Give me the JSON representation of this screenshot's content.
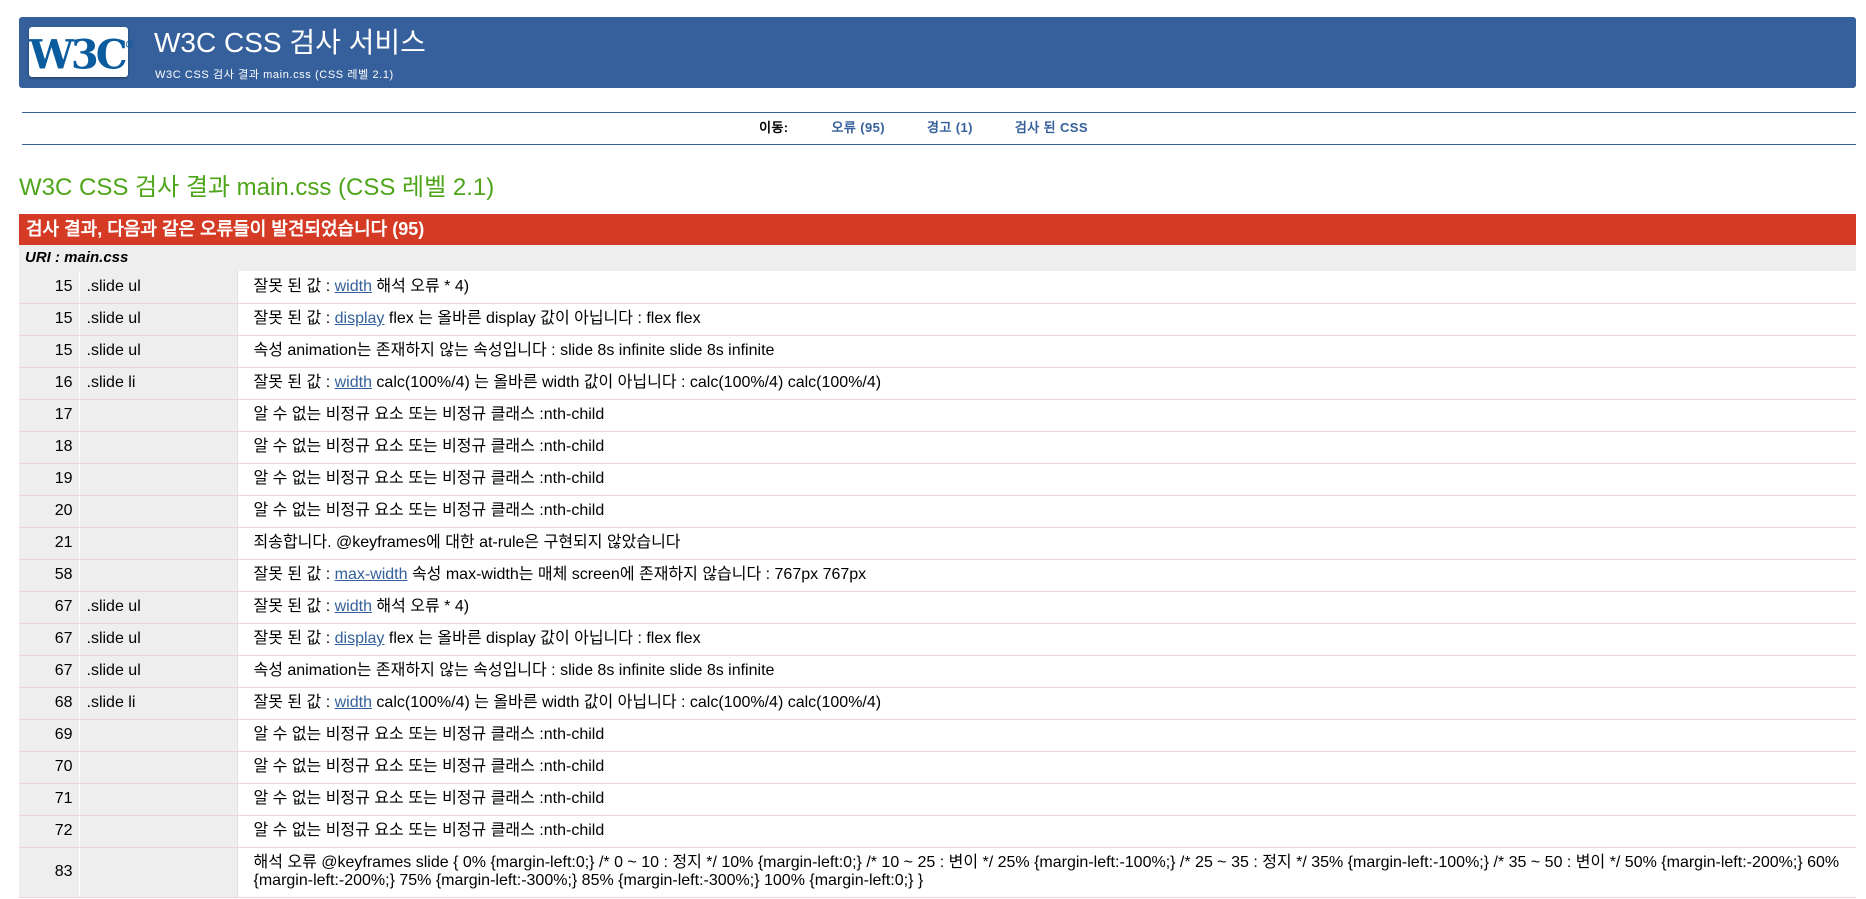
{
  "header": {
    "logo_text": "W3C",
    "title": "W3C CSS 검사 서비스",
    "subtitle": "W3C CSS 검사 결과 main.css (CSS 레벨 2.1)"
  },
  "jump": {
    "label": "이동:",
    "links": [
      "오류 (95)",
      "경고 (1)",
      "검사 된 CSS"
    ]
  },
  "result_title": "W3C CSS 검사 결과 main.css (CSS 레벨 2.1)",
  "errors_header": "검사 결과, 다음과 같은 오류들이 발견되었습니다 (95)",
  "uri": "URI : main.css",
  "errors": [
    {
      "line": "15",
      "ctx": ".slide ul",
      "pre": "잘못 된 값 : ",
      "prop": "width",
      "post": " 해석 오류 * 4)"
    },
    {
      "line": "15",
      "ctx": ".slide ul",
      "pre": "잘못 된 값 : ",
      "prop": "display",
      "post": " flex 는 올바른 display 값이 아닙니다 : flex flex"
    },
    {
      "line": "15",
      "ctx": ".slide ul",
      "pre": "속성 animation는 존재하지 않는 속성입니다 : slide 8s infinite slide 8s infinite",
      "prop": "",
      "post": ""
    },
    {
      "line": "16",
      "ctx": ".slide li",
      "pre": "잘못 된 값 : ",
      "prop": "width",
      "post": " calc(100%/4) 는 올바른 width 값이 아닙니다 : calc(100%/4) calc(100%/4)"
    },
    {
      "line": "17",
      "ctx": "",
      "pre": "알 수 없는 비정규 요소 또는 비정규 클래스 :nth-child",
      "prop": "",
      "post": ""
    },
    {
      "line": "18",
      "ctx": "",
      "pre": "알 수 없는 비정규 요소 또는 비정규 클래스 :nth-child",
      "prop": "",
      "post": ""
    },
    {
      "line": "19",
      "ctx": "",
      "pre": "알 수 없는 비정규 요소 또는 비정규 클래스 :nth-child",
      "prop": "",
      "post": ""
    },
    {
      "line": "20",
      "ctx": "",
      "pre": "알 수 없는 비정규 요소 또는 비정규 클래스 :nth-child",
      "prop": "",
      "post": ""
    },
    {
      "line": "21",
      "ctx": "",
      "pre": "죄송합니다. @keyframes에 대한 at-rule은 구현되지 않았습니다",
      "prop": "",
      "post": ""
    },
    {
      "line": "58",
      "ctx": "",
      "pre": "잘못 된 값 : ",
      "prop": "max-width",
      "post": " 속성 max-width는 매체 screen에 존재하지 않습니다 : 767px 767px"
    },
    {
      "line": "67",
      "ctx": ".slide ul",
      "pre": "잘못 된 값 : ",
      "prop": "width",
      "post": " 해석 오류 * 4)"
    },
    {
      "line": "67",
      "ctx": ".slide ul",
      "pre": "잘못 된 값 : ",
      "prop": "display",
      "post": " flex 는 올바른 display 값이 아닙니다 : flex flex"
    },
    {
      "line": "67",
      "ctx": ".slide ul",
      "pre": "속성 animation는 존재하지 않는 속성입니다 : slide 8s infinite slide 8s infinite",
      "prop": "",
      "post": ""
    },
    {
      "line": "68",
      "ctx": ".slide li",
      "pre": "잘못 된 값 : ",
      "prop": "width",
      "post": " calc(100%/4) 는 올바른 width 값이 아닙니다 : calc(100%/4) calc(100%/4)"
    },
    {
      "line": "69",
      "ctx": "",
      "pre": "알 수 없는 비정규 요소 또는 비정규 클래스 :nth-child",
      "prop": "",
      "post": ""
    },
    {
      "line": "70",
      "ctx": "",
      "pre": "알 수 없는 비정규 요소 또는 비정규 클래스 :nth-child",
      "prop": "",
      "post": ""
    },
    {
      "line": "71",
      "ctx": "",
      "pre": "알 수 없는 비정규 요소 또는 비정규 클래스 :nth-child",
      "prop": "",
      "post": ""
    },
    {
      "line": "72",
      "ctx": "",
      "pre": "알 수 없는 비정규 요소 또는 비정규 클래스 :nth-child",
      "prop": "",
      "post": ""
    },
    {
      "line": "83",
      "ctx": "",
      "pre": "해석 오류 @keyframes slide { 0% {margin-left:0;} /* 0 ~ 10 : 정지 */ 10% {margin-left:0;} /* 10 ~ 25 : 변이 */ 25% {margin-left:-100%;} /* 25 ~ 35 : 정지 */ 35% {margin-left:-100%;} /* 35 ~ 50 : 변이 */ 50% {margin-left:-200%;} 60% {margin-left:-200%;} 75% {margin-left:-300%;} 85% {margin-left:-300%;} 100% {margin-left:0;} }",
      "prop": "",
      "post": ""
    }
  ]
}
